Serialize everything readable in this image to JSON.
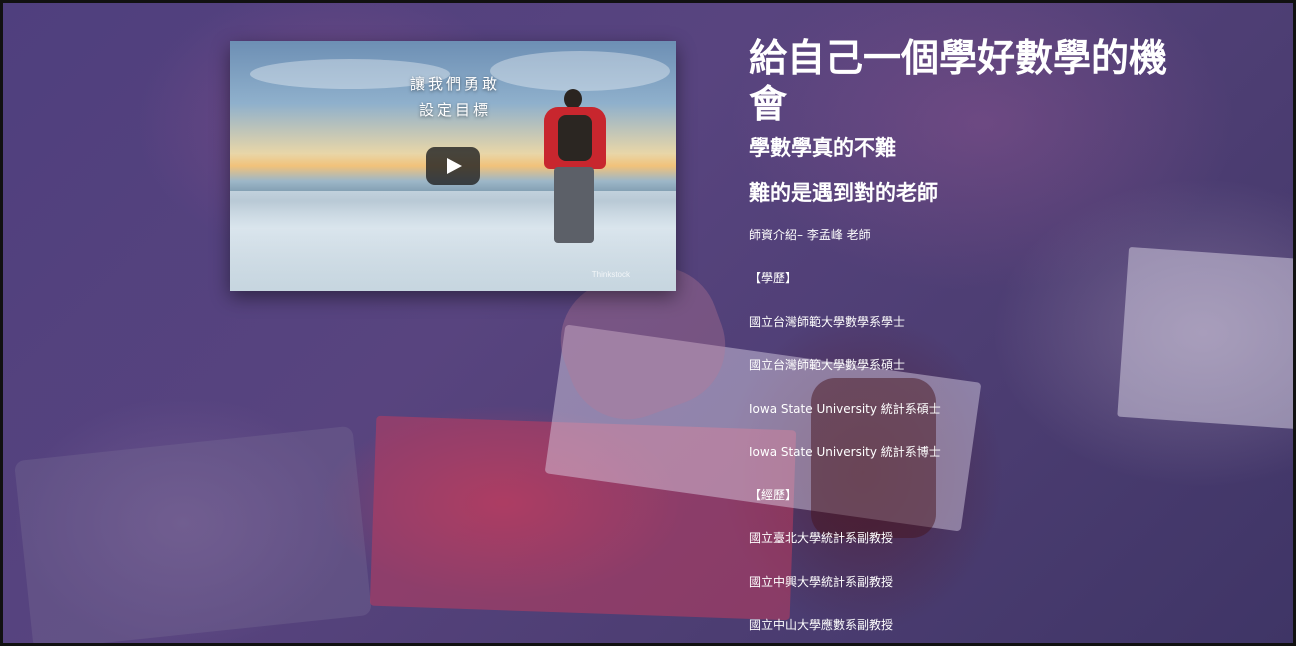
{
  "video": {
    "caption_line1": "讓我們勇敢",
    "caption_line2": "設定目標",
    "watermark": "Thinkstock",
    "play_icon": "play-icon"
  },
  "hero": {
    "title": "給自己一個學好數學的機會",
    "subtitle": "學數學真的不難",
    "subtitle2": "難的是遇到對的老師"
  },
  "bio": {
    "intro": "師資介紹– 李孟峰 老師",
    "education_heading": "【學歷】",
    "education": [
      "國立台灣師範大學數學系學士",
      "國立台灣師範大學數學系碩士",
      "Iowa State University 統計系碩士",
      "Iowa State University 統計系博士"
    ],
    "experience_heading": "【經歷】",
    "experience": [
      "國立臺北大學統計系副教授",
      "國立中興大學統計系副教授",
      "國立中山大學應數系副教授"
    ]
  }
}
